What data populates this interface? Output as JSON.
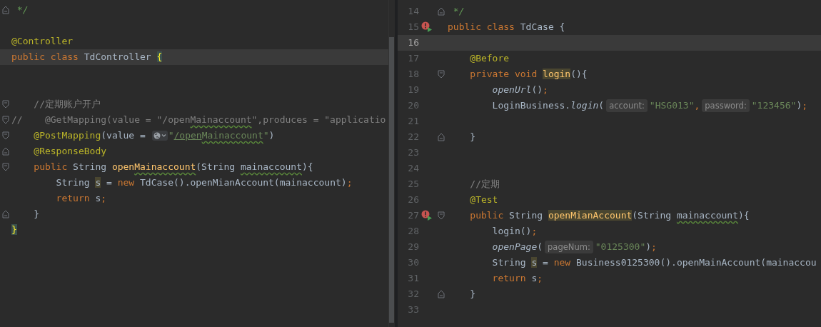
{
  "left_editor": {
    "lines": [
      {
        "fold_start": false,
        "fold_end": true,
        "current": false,
        "tokens": [
          {
            "kind": "doc",
            "text": " */"
          }
        ]
      },
      {
        "fold_start": false,
        "fold_end": false,
        "current": false
      },
      {
        "fold_start": false,
        "fold_end": false,
        "current": false,
        "tokens": [
          {
            "kind": "ann",
            "text": "@Controller"
          }
        ]
      },
      {
        "fold_start": false,
        "fold_end": false,
        "current": true,
        "tokens": [
          {
            "kind": "kw",
            "text": "public class "
          },
          {
            "kind": "plain",
            "text": "TdController "
          },
          {
            "kind": "brace",
            "text": "{"
          }
        ]
      },
      {
        "fold_start": false,
        "fold_end": false,
        "current": false
      },
      {
        "fold_start": false,
        "fold_end": false,
        "current": false
      },
      {
        "fold_start": true,
        "fold_end": false,
        "current": false,
        "tokens": [
          {
            "kind": "cmt",
            "text": "    //定期账户开户"
          }
        ]
      },
      {
        "fold_start": true,
        "fold_end": false,
        "current": false,
        "tokens": [
          {
            "kind": "cmt",
            "text": "//    @GetMapping(value = \"/open"
          },
          {
            "kind": "cmt-warn",
            "text": "Mainaccount"
          },
          {
            "kind": "cmt",
            "text": "\",produces = \"applicatio"
          }
        ]
      },
      {
        "fold_start": true,
        "fold_end": false,
        "current": false,
        "tokens": [
          {
            "kind": "ann",
            "text": "    @PostMapping"
          },
          {
            "kind": "plain",
            "text": "(value = "
          },
          {
            "kind": "link-icon"
          },
          {
            "kind": "str",
            "text": "\""
          },
          {
            "kind": "link",
            "text": "/open"
          },
          {
            "kind": "link-warn",
            "text": "Mainaccount"
          },
          {
            "kind": "str",
            "text": "\""
          },
          {
            "kind": "plain",
            "text": ")"
          }
        ]
      },
      {
        "fold_start": false,
        "fold_end": true,
        "current": false,
        "tokens": [
          {
            "kind": "ann",
            "text": "    @ResponseBody"
          }
        ]
      },
      {
        "fold_start": true,
        "fold_end": false,
        "current": false,
        "tokens": [
          {
            "kind": "kw",
            "text": "    public "
          },
          {
            "kind": "plain",
            "text": "String "
          },
          {
            "kind": "fn",
            "text": "open"
          },
          {
            "kind": "fn-warn",
            "text": "Mainaccount"
          },
          {
            "kind": "plain",
            "text": "(String "
          },
          {
            "kind": "warn",
            "text": "mainaccount"
          },
          {
            "kind": "plain",
            "text": "){"
          }
        ]
      },
      {
        "fold_start": false,
        "fold_end": false,
        "current": false,
        "tokens": [
          {
            "kind": "plain",
            "text": "        String "
          },
          {
            "kind": "var-hl",
            "text": "s"
          },
          {
            "kind": "plain",
            "text": " = "
          },
          {
            "kind": "kw",
            "text": "new "
          },
          {
            "kind": "plain",
            "text": "TdCase().openMianAccount(mainaccount)"
          },
          {
            "kind": "kw",
            "text": ";"
          }
        ]
      },
      {
        "fold_start": false,
        "fold_end": false,
        "current": false,
        "tokens": [
          {
            "kind": "kw",
            "text": "        return "
          },
          {
            "kind": "plain",
            "text": "s"
          },
          {
            "kind": "kw",
            "text": ";"
          }
        ]
      },
      {
        "fold_start": false,
        "fold_end": true,
        "current": false,
        "tokens": [
          {
            "kind": "plain",
            "text": "    }"
          }
        ]
      },
      {
        "fold_start": false,
        "fold_end": false,
        "current": false,
        "tokens": [
          {
            "kind": "brace",
            "text": "}"
          }
        ]
      }
    ]
  },
  "right_editor": {
    "lines": [
      {
        "number": "14",
        "runnable": false,
        "fold_start": false,
        "fold_end": true,
        "current": false,
        "tokens": [
          {
            "kind": "doc",
            "text": " */"
          }
        ]
      },
      {
        "number": "15",
        "runnable": true,
        "fold_start": false,
        "fold_end": false,
        "current": false,
        "tokens": [
          {
            "kind": "kw",
            "text": "public class "
          },
          {
            "kind": "plain",
            "text": "TdCase {"
          }
        ]
      },
      {
        "number": "16",
        "runnable": false,
        "fold_start": false,
        "fold_end": false,
        "current": true
      },
      {
        "number": "17",
        "runnable": false,
        "fold_start": false,
        "fold_end": false,
        "current": false,
        "tokens": [
          {
            "kind": "ann",
            "text": "    @Before"
          }
        ]
      },
      {
        "number": "18",
        "runnable": false,
        "fold_start": true,
        "fold_end": false,
        "current": false,
        "tokens": [
          {
            "kind": "kw",
            "text": "    private void "
          },
          {
            "kind": "fn-hl",
            "text": "login"
          },
          {
            "kind": "plain",
            "text": "(){"
          }
        ]
      },
      {
        "number": "19",
        "runnable": false,
        "fold_start": false,
        "fold_end": false,
        "current": false,
        "tokens": [
          {
            "kind": "italic",
            "text": "        openUrl"
          },
          {
            "kind": "plain",
            "text": "()"
          },
          {
            "kind": "kw",
            "text": ";"
          }
        ]
      },
      {
        "number": "20",
        "runnable": false,
        "fold_start": false,
        "fold_end": false,
        "current": false,
        "tokens": [
          {
            "kind": "plain",
            "text": "        LoginBusiness."
          },
          {
            "kind": "italic",
            "text": "login"
          },
          {
            "kind": "plain",
            "text": "("
          },
          {
            "kind": "hint",
            "text": "account:"
          },
          {
            "kind": "str",
            "text": "\"HSG013\""
          },
          {
            "kind": "kw",
            "text": ","
          },
          {
            "kind": "hint",
            "text": "password:"
          },
          {
            "kind": "str",
            "text": "\"123456\""
          },
          {
            "kind": "plain",
            "text": ")"
          },
          {
            "kind": "kw",
            "text": ";"
          }
        ]
      },
      {
        "number": "21",
        "runnable": false,
        "fold_start": false,
        "fold_end": false,
        "current": false
      },
      {
        "number": "22",
        "runnable": false,
        "fold_start": false,
        "fold_end": true,
        "current": false,
        "tokens": [
          {
            "kind": "plain",
            "text": "    }"
          }
        ]
      },
      {
        "number": "23",
        "runnable": false,
        "fold_start": false,
        "fold_end": false,
        "current": false
      },
      {
        "number": "24",
        "runnable": false,
        "fold_start": false,
        "fold_end": false,
        "current": false
      },
      {
        "number": "25",
        "runnable": false,
        "fold_start": false,
        "fold_end": false,
        "current": false,
        "tokens": [
          {
            "kind": "cmt",
            "text": "    //定期"
          }
        ]
      },
      {
        "number": "26",
        "runnable": false,
        "fold_start": false,
        "fold_end": false,
        "current": false,
        "tokens": [
          {
            "kind": "ann",
            "text": "    @Test"
          }
        ]
      },
      {
        "number": "27",
        "runnable": true,
        "fold_start": true,
        "fold_end": false,
        "current": false,
        "tokens": [
          {
            "kind": "kw",
            "text": "    public "
          },
          {
            "kind": "plain",
            "text": "String "
          },
          {
            "kind": "fn-hl",
            "text": "openMianAccount"
          },
          {
            "kind": "plain",
            "text": "(String "
          },
          {
            "kind": "warn",
            "text": "mainaccount"
          },
          {
            "kind": "plain",
            "text": "){"
          }
        ]
      },
      {
        "number": "28",
        "runnable": false,
        "fold_start": false,
        "fold_end": false,
        "current": false,
        "tokens": [
          {
            "kind": "plain",
            "text": "        login()"
          },
          {
            "kind": "kw",
            "text": ";"
          }
        ]
      },
      {
        "number": "29",
        "runnable": false,
        "fold_start": false,
        "fold_end": false,
        "current": false,
        "tokens": [
          {
            "kind": "italic",
            "text": "        openPage"
          },
          {
            "kind": "plain",
            "text": "("
          },
          {
            "kind": "hint",
            "text": "pageNum:"
          },
          {
            "kind": "str",
            "text": "\"0125300\""
          },
          {
            "kind": "plain",
            "text": ")"
          },
          {
            "kind": "kw",
            "text": ";"
          }
        ]
      },
      {
        "number": "30",
        "runnable": false,
        "fold_start": false,
        "fold_end": false,
        "current": false,
        "tokens": [
          {
            "kind": "plain",
            "text": "        String "
          },
          {
            "kind": "var-hl",
            "text": "s"
          },
          {
            "kind": "plain",
            "text": " = "
          },
          {
            "kind": "kw",
            "text": "new "
          },
          {
            "kind": "plain",
            "text": "Business0125300().openMainAccount(mainaccou"
          }
        ]
      },
      {
        "number": "31",
        "runnable": false,
        "fold_start": false,
        "fold_end": false,
        "current": false,
        "tokens": [
          {
            "kind": "kw",
            "text": "        return "
          },
          {
            "kind": "plain",
            "text": "s"
          },
          {
            "kind": "kw",
            "text": ";"
          }
        ]
      },
      {
        "number": "32",
        "runnable": false,
        "fold_start": false,
        "fold_end": true,
        "current": false,
        "tokens": [
          {
            "kind": "plain",
            "text": "    }"
          }
        ]
      },
      {
        "number": "33",
        "runnable": false,
        "fold_start": false,
        "fold_end": false,
        "current": false
      }
    ]
  }
}
